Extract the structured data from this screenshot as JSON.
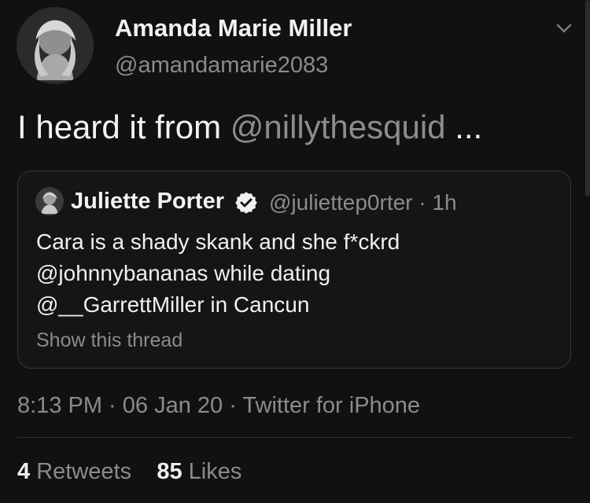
{
  "tweet": {
    "author_name": "Amanda Marie Miller",
    "author_handle": "@amandamarie2083",
    "text_prefix": "I heard it from ",
    "mention": "@nillythesquid",
    "text_suffix": " ...",
    "timestamp": "8:13 PM · 06 Jan 20 · Twitter for iPhone",
    "retweets_count": "4",
    "retweets_label": "Retweets",
    "likes_count": "85",
    "likes_label": "Likes"
  },
  "quoted_tweet": {
    "author_name": "Juliette Porter",
    "author_handle": "@juliettep0rter",
    "time_ago": "1h",
    "body": "Cara is a shady skank and she f*ckrd\n@johnnybananas while dating\n@__GarrettMiller in Cancun",
    "show_thread": "Show this thread"
  },
  "icons": {
    "menu": "chevron-down-icon",
    "verified": "verified-badge-icon",
    "avatar": "avatar-image",
    "quoted_avatar": "quoted-avatar-image"
  },
  "colors": {
    "background": "#111111",
    "primary_text": "#f2f2f2",
    "secondary_text": "#8b8b8b",
    "border": "#373737"
  }
}
